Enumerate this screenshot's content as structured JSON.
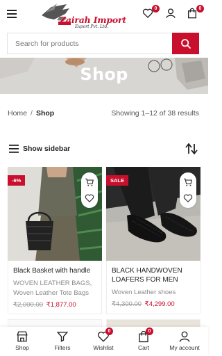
{
  "header": {
    "brand_name": "Zairah Import",
    "brand_sub": "Export Pvt. Ltd.",
    "wishlist_count": "0",
    "cart_count": "0"
  },
  "search": {
    "placeholder": "Search for products"
  },
  "banner": {
    "title": "Shop"
  },
  "breadcrumb": {
    "home": "Home",
    "separator": "/",
    "current": "Shop"
  },
  "results_text": "Showing 1–12 of 38 results",
  "sidebar_toggle": "Show sidebar",
  "products": [
    {
      "tag": "-6%",
      "name": "Black Basket with handle",
      "categories": "WOVEN LEATHER BAGS, Woven Leather Tote Bags",
      "old_price": "₹2,000.00",
      "price": "₹1,877.00"
    },
    {
      "tag": "SALE",
      "name": "BLACK HANDWOVEN LOAFERS FOR MEN",
      "categories": "Woven Leather shoes",
      "old_price": "₹4,300.00",
      "price": "₹4,299.00"
    }
  ],
  "bottom_nav": {
    "shop": "Shop",
    "filters": "Filters",
    "wishlist": "Wishlist",
    "wishlist_count": "0",
    "cart": "Cart",
    "cart_count": "0",
    "account": "My account"
  },
  "colors": {
    "accent": "#c8102e",
    "banner": "#d8d6d3"
  }
}
